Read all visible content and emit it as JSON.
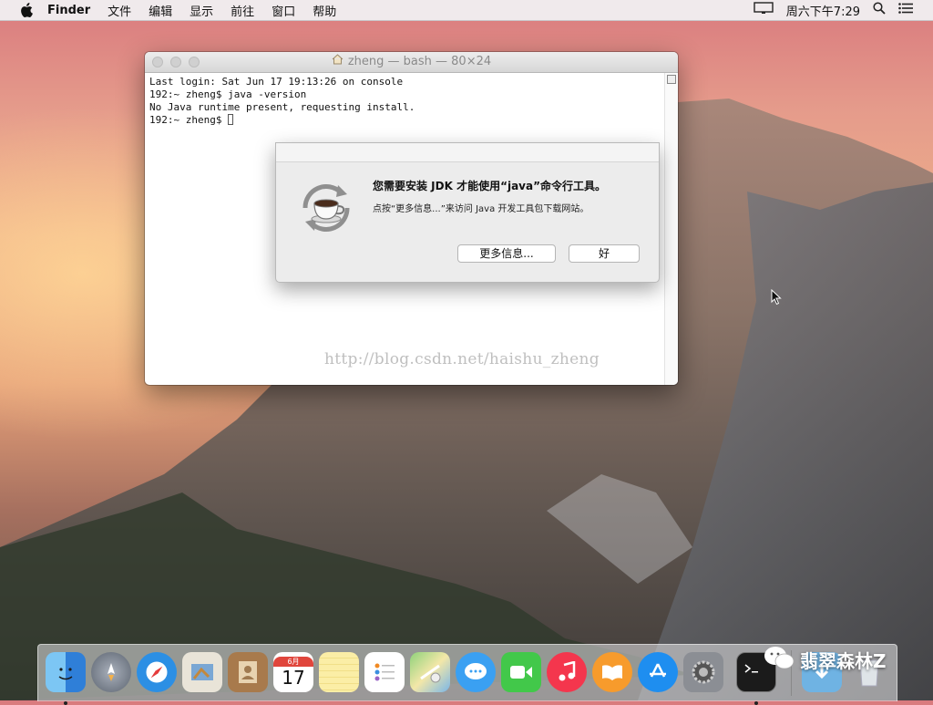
{
  "menubar": {
    "app_name": "Finder",
    "items": [
      "文件",
      "编辑",
      "显示",
      "前往",
      "窗口",
      "帮助"
    ],
    "clock": "周六下午7:29"
  },
  "terminal": {
    "title": "zheng — bash — 80×24",
    "lines": [
      "Last login: Sat Jun 17 19:13:26 on console",
      "192:~ zheng$ java -version",
      "No Java runtime present, requesting install.",
      "192:~ zheng$ "
    ],
    "watermark": "http://blog.csdn.net/haishu_zheng"
  },
  "dialog": {
    "title": "您需要安装 JDK 才能使用“java”命令行工具。",
    "message": "点按“更多信息...”来访问 Java 开发工具包下载网站。",
    "more_info_label": "更多信息...",
    "ok_label": "好"
  },
  "dock": {
    "calendar_month": "6月",
    "calendar_day": "17",
    "items": [
      "finder-icon",
      "launchpad-icon",
      "safari-icon",
      "mail-icon",
      "contacts-icon",
      "calendar-icon",
      "notes-icon",
      "reminders-icon",
      "maps-icon",
      "messages-icon",
      "facetime-icon",
      "itunes-icon",
      "ibooks-icon",
      "app-store-icon",
      "system-preferences-icon",
      "terminal-icon",
      "downloads-icon",
      "trash-icon"
    ]
  },
  "overlay_watermark": "翡翠森林Z",
  "colors": {
    "menubar_bg": "#f0eef0",
    "dialog_bg": "#ececec",
    "terminal_bg": "#ffffff"
  }
}
